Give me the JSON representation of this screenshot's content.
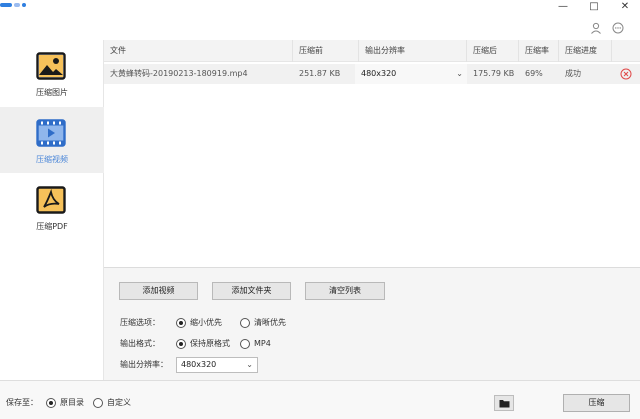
{
  "window": {
    "title_chars": "",
    "minimize_glyph": "—",
    "maximize_glyph": "□",
    "close_glyph": "✕"
  },
  "sidebar": {
    "items": [
      {
        "label": "压缩图片",
        "icon": "image-icon",
        "active": false
      },
      {
        "label": "压缩视频",
        "icon": "video-icon",
        "active": true
      },
      {
        "label": "压缩PDF",
        "icon": "pdf-icon",
        "active": false
      }
    ]
  },
  "table": {
    "headers": {
      "file": "文件",
      "before": "压缩前",
      "resolution": "输出分辨率",
      "after": "压缩后",
      "ratio": "压缩率",
      "progress": "压缩进度"
    },
    "rows": [
      {
        "file": "大黄蜂转码-20190213-180919.mp4",
        "before": "251.87 KB",
        "resolution": "480x320",
        "after": "175.79 KB",
        "ratio": "69%",
        "progress": "成功"
      }
    ]
  },
  "actions": {
    "add_video": "添加视频",
    "add_folder": "添加文件夹",
    "clear_list": "清空列表"
  },
  "options": {
    "compress_label": "压缩选项：",
    "compress_small": "缩小优先",
    "compress_clear": "清晰优先",
    "format_label": "输出格式：",
    "format_keep": "保持原格式",
    "format_mp4": "MP4",
    "resolution_label": "输出分辨率：",
    "resolution_value": "480x320"
  },
  "bottom": {
    "save_label": "保存至：",
    "save_original": "原目录",
    "save_custom": "自定义",
    "compress_button": "压缩"
  },
  "colors": {
    "accent": "#4a86d8",
    "delete": "#e04848",
    "active_sidebar": "#efefef"
  }
}
